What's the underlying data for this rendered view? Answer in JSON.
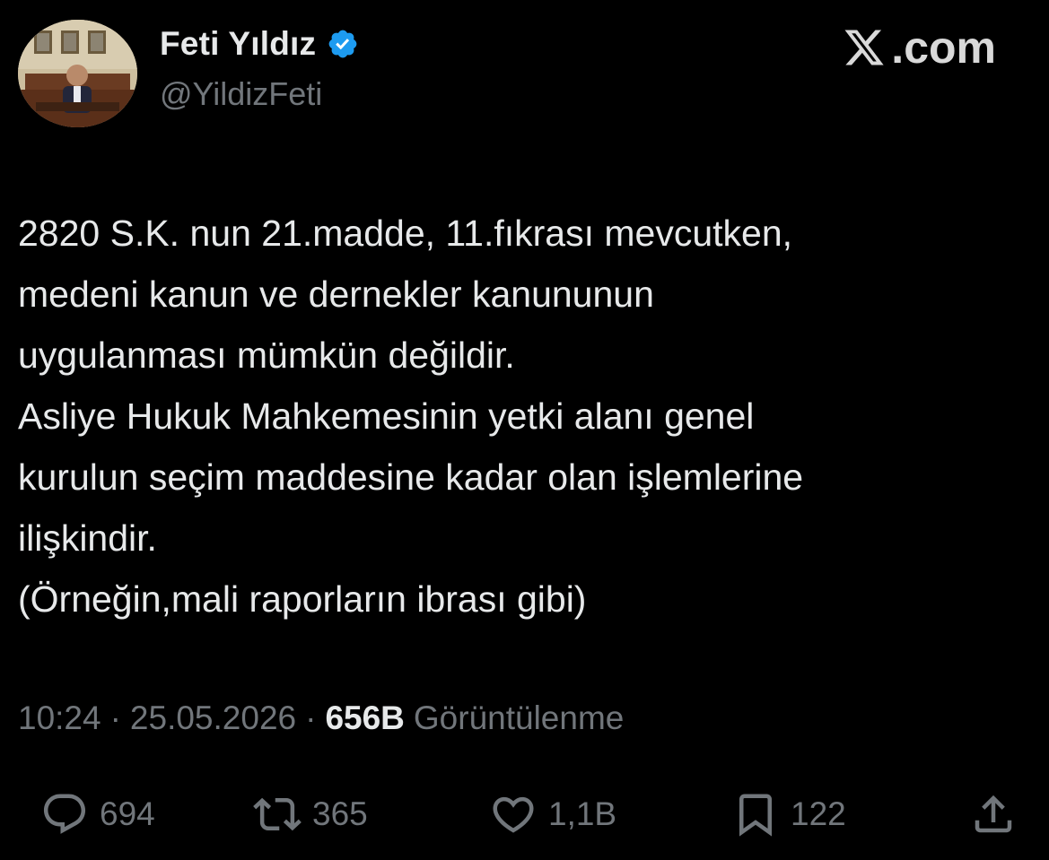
{
  "author": {
    "display_name": "Feti Yıldız",
    "handle": "@YildizFeti",
    "verified_icon": "verified-badge-icon",
    "avatar": "avatar-photo"
  },
  "brand": {
    "logo_icon": "x-logo-icon",
    "suffix": ".com"
  },
  "tweet": {
    "lines": [
      "2820 S.K. nun 21.madde, 11.fıkrası mevcutken,",
      "medeni kanun ve dernekler kanununun",
      "uygulanması mümkün değildir.",
      "Asliye Hukuk Mahkemesinin yetki alanı genel",
      "kurulun seçim maddesine kadar olan işlemlerine",
      "ilişkindir.",
      "(Örneğin,mali raporların ibrası gibi)"
    ]
  },
  "meta": {
    "time": "10:24",
    "separator": "·",
    "date": "25.05.2026",
    "views_count": "656B",
    "views_label": "Görüntülenme"
  },
  "actions": {
    "reply": {
      "icon": "reply-icon",
      "count": "694"
    },
    "retweet": {
      "icon": "retweet-icon",
      "count": "365"
    },
    "like": {
      "icon": "heart-icon",
      "count": "1,1B"
    },
    "bookmark": {
      "icon": "bookmark-icon",
      "count": "122"
    },
    "share": {
      "icon": "share-icon"
    }
  },
  "colors": {
    "background": "#000000",
    "text_primary": "#e7e9ea",
    "text_secondary": "#71767b",
    "verified_blue": "#1d9bf0"
  }
}
